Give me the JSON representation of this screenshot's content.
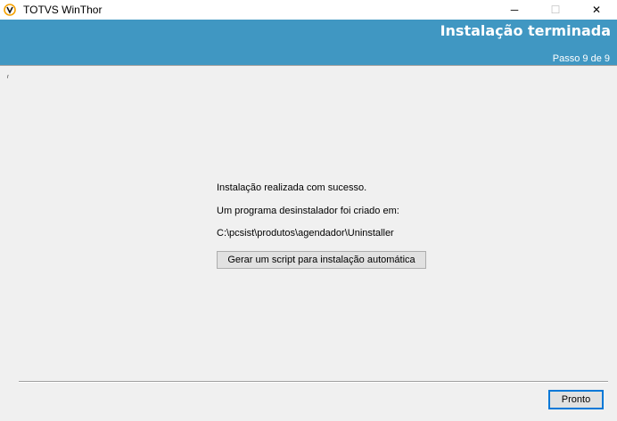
{
  "window": {
    "title": "TOTVS WinThor",
    "minimize_glyph": "─",
    "maximize_glyph": "☐",
    "close_glyph": "✕",
    "icon": "totvs-logo-icon"
  },
  "header": {
    "title": "Instalação terminada",
    "step": "Passo 9 de 9",
    "color": "#4097c2"
  },
  "body": {
    "corner_mark": "ʳ",
    "success_message": "Instalação realizada com sucesso.",
    "uninstaller_message": "Um programa desinstalador foi criado em:",
    "uninstaller_path": "C:\\pcsist\\produtos\\agendador\\Uninstaller",
    "script_button_label": "Gerar um script para instalação automática"
  },
  "footer": {
    "done_button_label": "Pronto"
  }
}
